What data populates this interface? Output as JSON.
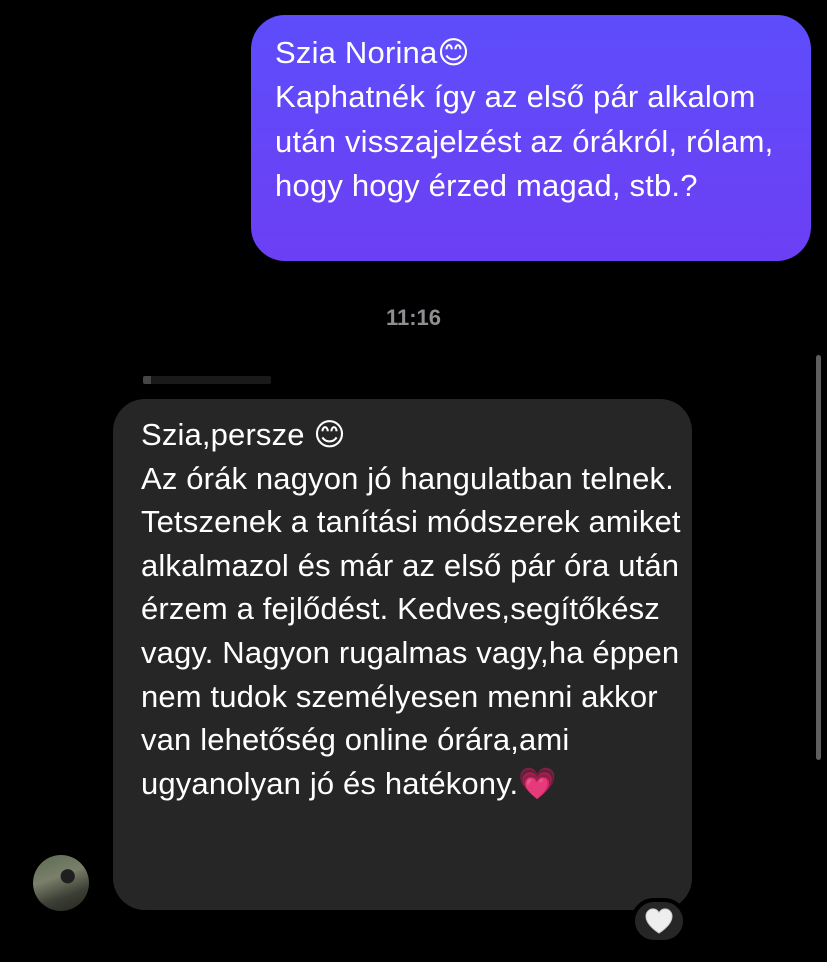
{
  "conversation": {
    "outgoing_message": {
      "text": "Szia Norina😊\nKaphatnék így az első pár alkalom után visszajelzést az órákról, rólam, hogy hogy érzed magad, stb.?"
    },
    "timestamp": "11:16",
    "incoming_message": {
      "text": "Szia,persze 😊\nAz órák nagyon jó hangulatban telnek. Tetszenek a tanítási módszerek amiket alkalmazol és már az első pár óra után érzem a fejlődést. Kedves,segítőkész vagy. Nagyon rugalmas vagy,ha éppen nem tudok személyesen menni akkor van lehetőség online órára,ami ugyanolyan jó és hatékony.💗",
      "reaction": "white-heart-icon"
    }
  },
  "colors": {
    "background": "#000000",
    "outgoing_bubble": "#6346f8",
    "incoming_bubble": "#262626",
    "timestamp_text": "#8e8e93"
  }
}
